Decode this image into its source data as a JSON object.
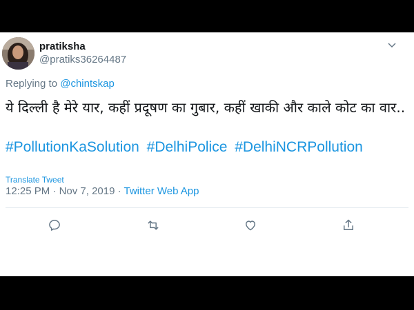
{
  "tweet": {
    "author": {
      "name": "pratiksha",
      "handle": "@pratiks36264487"
    },
    "replying_prefix": "Replying to ",
    "replying_to": "@chintskap",
    "text": "ये दिल्ली है मेरे यार, कहीं प्रदूषण का गुबार, कहीं खाकी और काले कोट का वार..",
    "hashtags": [
      "#PollutionKaSolution",
      "#DelhiPolice",
      "#DelhiNCRPollution"
    ],
    "translate_label": "Translate Tweet",
    "time": "12:25 PM",
    "separator": " · ",
    "date": "Nov 7, 2019",
    "app": "Twitter Web App"
  },
  "actions": [
    {
      "icon": "reply-icon"
    },
    {
      "icon": "retweet-icon"
    },
    {
      "icon": "like-icon"
    },
    {
      "icon": "share-icon"
    }
  ],
  "colors": {
    "link": "#1b95e0",
    "text": "#14171a",
    "muted": "#657786"
  }
}
